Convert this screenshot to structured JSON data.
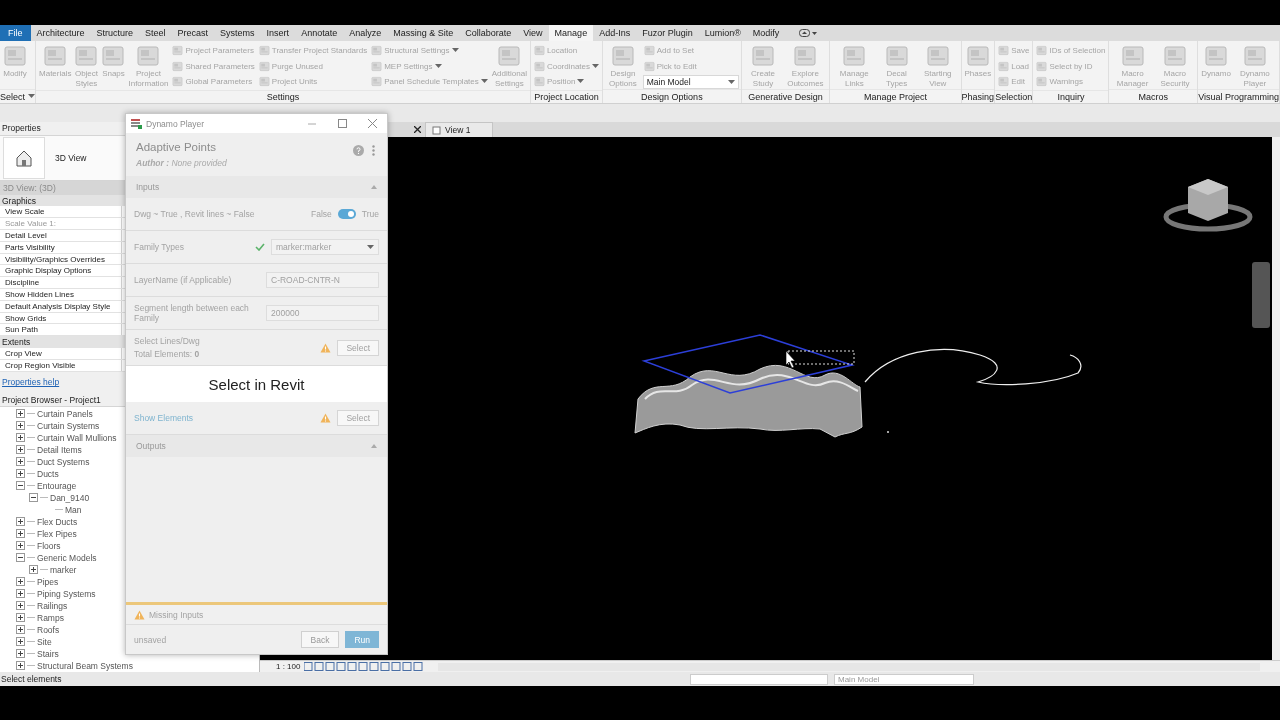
{
  "ribbon": {
    "tabs": [
      {
        "label": "File",
        "kind": "application",
        "selected": false
      },
      {
        "label": "Architecture",
        "kind": "tab",
        "selected": false
      },
      {
        "label": "Structure",
        "kind": "tab",
        "selected": false
      },
      {
        "label": "Steel",
        "kind": "tab",
        "selected": false
      },
      {
        "label": "Precast",
        "kind": "tab",
        "selected": false
      },
      {
        "label": "Systems",
        "kind": "tab",
        "selected": false
      },
      {
        "label": "Insert",
        "kind": "tab",
        "selected": false
      },
      {
        "label": "Annotate",
        "kind": "tab",
        "selected": false
      },
      {
        "label": "Analyze",
        "kind": "tab",
        "selected": false
      },
      {
        "label": "Massing & Site",
        "kind": "tab",
        "selected": false
      },
      {
        "label": "Collaborate",
        "kind": "tab",
        "selected": false
      },
      {
        "label": "View",
        "kind": "tab",
        "selected": false
      },
      {
        "label": "Manage",
        "kind": "tab",
        "selected": true
      },
      {
        "label": "Add-Ins",
        "kind": "tab",
        "selected": false
      },
      {
        "label": "Fuzor Plugin",
        "kind": "tab",
        "selected": false
      },
      {
        "label": "Lumion®",
        "kind": "tab",
        "selected": false
      },
      {
        "label": "Modify",
        "kind": "tab",
        "selected": false
      }
    ],
    "panels": [
      {
        "label": "Select",
        "menu": true,
        "groups": [
          {
            "kind": "large",
            "items": [
              {
                "label": "Modify"
              }
            ]
          }
        ]
      },
      {
        "label": "Settings",
        "menu": false,
        "groups": [
          {
            "kind": "large",
            "items": [
              {
                "label": "Materials"
              },
              {
                "label": "Object Styles"
              },
              {
                "label": "Snaps"
              },
              {
                "label": "Project Information"
              }
            ]
          },
          {
            "kind": "stack",
            "items": [
              {
                "kind": "tool",
                "label": "Project Parameters",
                "menu": false
              },
              {
                "kind": "tool",
                "label": "Shared Parameters",
                "menu": false
              },
              {
                "kind": "tool",
                "label": "Global Parameters",
                "menu": false
              }
            ]
          },
          {
            "kind": "stack",
            "items": [
              {
                "kind": "tool",
                "label": "Transfer Project Standards",
                "menu": false
              },
              {
                "kind": "tool",
                "label": "Purge Unused",
                "menu": false
              },
              {
                "kind": "tool",
                "label": "Project Units",
                "menu": false
              }
            ]
          },
          {
            "kind": "stack",
            "items": [
              {
                "kind": "tool",
                "label": "Structural Settings",
                "menu": true
              },
              {
                "kind": "tool",
                "label": "MEP Settings",
                "menu": true
              },
              {
                "kind": "tool",
                "label": "Panel Schedule Templates",
                "menu": true
              }
            ]
          },
          {
            "kind": "large",
            "items": [
              {
                "label": "Additional Settings"
              }
            ]
          }
        ]
      },
      {
        "label": "Project Location",
        "menu": false,
        "groups": [
          {
            "kind": "stack",
            "items": [
              {
                "kind": "tool",
                "label": "Location",
                "menu": false
              },
              {
                "kind": "tool",
                "label": "Coordinates",
                "menu": true
              },
              {
                "kind": "tool",
                "label": "Position",
                "menu": true
              }
            ]
          }
        ]
      },
      {
        "label": "Design Options",
        "menu": false,
        "groups": [
          {
            "kind": "large",
            "items": [
              {
                "label": "Design Options"
              }
            ]
          },
          {
            "kind": "stack",
            "items": [
              {
                "kind": "tool",
                "label": "Add to Set",
                "menu": false
              },
              {
                "kind": "tool",
                "label": "Pick to Edit",
                "menu": false
              },
              {
                "kind": "combo",
                "label": "Main Model",
                "menu": true
              }
            ]
          }
        ]
      },
      {
        "label": "Generative Design",
        "menu": false,
        "groups": [
          {
            "kind": "large",
            "items": [
              {
                "label": "Create Study"
              },
              {
                "label": "Explore Outcomes"
              }
            ]
          }
        ]
      },
      {
        "label": "Manage Project",
        "menu": false,
        "groups": [
          {
            "kind": "large",
            "items": [
              {
                "label": "Manage Links"
              },
              {
                "label": "Decal Types"
              },
              {
                "label": "Starting View"
              }
            ]
          }
        ]
      },
      {
        "label": "Phasing",
        "menu": false,
        "groups": [
          {
            "kind": "large",
            "items": [
              {
                "label": "Phases"
              }
            ]
          }
        ]
      },
      {
        "label": "Selection",
        "menu": false,
        "groups": [
          {
            "kind": "stack",
            "items": [
              {
                "kind": "tool",
                "label": "Save",
                "menu": false
              },
              {
                "kind": "tool",
                "label": "Load",
                "menu": false
              },
              {
                "kind": "tool",
                "label": "Edit",
                "menu": false
              }
            ]
          }
        ]
      },
      {
        "label": "Inquiry",
        "menu": false,
        "groups": [
          {
            "kind": "stack",
            "items": [
              {
                "kind": "tool",
                "label": "IDs of Selection",
                "menu": false
              },
              {
                "kind": "tool",
                "label": "Select by ID",
                "menu": false
              },
              {
                "kind": "tool",
                "label": "Warnings",
                "menu": false
              }
            ]
          }
        ]
      },
      {
        "label": "Macros",
        "menu": false,
        "groups": [
          {
            "kind": "large",
            "items": [
              {
                "label": "Macro Manager"
              },
              {
                "label": "Macro Security"
              }
            ]
          }
        ]
      },
      {
        "label": "Visual Programming",
        "menu": false,
        "groups": [
          {
            "kind": "large",
            "items": [
              {
                "label": "Dynamo"
              },
              {
                "label": "Dynamo Player"
              }
            ]
          }
        ]
      }
    ]
  },
  "properties": {
    "title": "Properties",
    "type_name": "3D View",
    "selector": "3D View: (3D)",
    "groups": [
      {
        "name": "Graphics",
        "rows": [
          {
            "label": "View Scale",
            "disabled": false
          },
          {
            "label": "Scale Value    1:",
            "disabled": true
          },
          {
            "label": "Detail Level",
            "disabled": false
          },
          {
            "label": "Parts Visibility",
            "disabled": false
          },
          {
            "label": "Visibility/Graphics Overrides",
            "disabled": false
          },
          {
            "label": "Graphic Display Options",
            "disabled": false
          },
          {
            "label": "Discipline",
            "disabled": false
          },
          {
            "label": "Show Hidden Lines",
            "disabled": false
          },
          {
            "label": "Default Analysis Display Style",
            "disabled": false
          },
          {
            "label": "Show Grids",
            "disabled": false
          },
          {
            "label": "Sun Path",
            "disabled": false
          }
        ]
      },
      {
        "name": "Extents",
        "rows": [
          {
            "label": "Crop View",
            "disabled": false
          },
          {
            "label": "Crop Region Visible",
            "disabled": false
          }
        ]
      }
    ],
    "help_link": "Properties help"
  },
  "project_browser": {
    "title": "Project Browser - Project1",
    "tree": [
      {
        "label": "Curtain Panels",
        "expanded": false
      },
      {
        "label": "Curtain Systems",
        "expanded": false
      },
      {
        "label": "Curtain Wall Mullions",
        "expanded": false
      },
      {
        "label": "Detail Items",
        "expanded": false
      },
      {
        "label": "Duct Systems",
        "expanded": false
      },
      {
        "label": "Ducts",
        "expanded": false
      },
      {
        "label": "Entourage",
        "expanded": true,
        "children": [
          {
            "label": "Dan_9140",
            "expanded": true,
            "children": [
              {
                "label": "Man"
              }
            ]
          }
        ]
      },
      {
        "label": "Flex Ducts",
        "expanded": false
      },
      {
        "label": "Flex Pipes",
        "expanded": false
      },
      {
        "label": "Floors",
        "expanded": false
      },
      {
        "label": "Generic Models",
        "expanded": true,
        "children": [
          {
            "label": "marker",
            "expanded": false
          }
        ]
      },
      {
        "label": "Pipes",
        "expanded": false
      },
      {
        "label": "Piping Systems",
        "expanded": false
      },
      {
        "label": "Railings",
        "expanded": false
      },
      {
        "label": "Ramps",
        "expanded": false
      },
      {
        "label": "Roofs",
        "expanded": false
      },
      {
        "label": "Site",
        "expanded": false
      },
      {
        "label": "Stairs",
        "expanded": false
      },
      {
        "label": "Structural Beam Systems",
        "expanded": false
      }
    ]
  },
  "view": {
    "tabs": [
      {
        "label": "View 1"
      }
    ],
    "scale": "1 : 100"
  },
  "dynamo_player": {
    "window_title": "Dynamo Player",
    "graph_title": "Adaptive Points",
    "author": "**Author :** None provided",
    "inputs_label": "Inputs",
    "inputs": [
      {
        "kind": "toggle",
        "label": "Dwg ~ True , Revit lines ~ False",
        "off_label": "False",
        "on_label": "True",
        "on": true
      },
      {
        "kind": "dropdown",
        "label": "Family Types",
        "valid": true,
        "value": "marker:marker"
      },
      {
        "kind": "text",
        "label": "LayerName (if Applicable)",
        "value": "C-ROAD-CNTR-N"
      },
      {
        "kind": "text",
        "label": "Segment length between each Family",
        "value": "200000"
      },
      {
        "kind": "select",
        "label": "Select Lines/Dwg",
        "count": "Total Elements: **0**",
        "warning": true,
        "button": "Select"
      },
      {
        "kind": "banner",
        "label": "Select in Revit"
      },
      {
        "kind": "select",
        "link": "Show Elements",
        "warning": true,
        "button": "Select"
      }
    ],
    "outputs_label": "Outputs",
    "status": "Missing Inputs",
    "file_state": "unsaved",
    "buttons": [
      {
        "label": "Back",
        "kind": "secondary"
      },
      {
        "label": "Run",
        "kind": "primary"
      }
    ]
  },
  "status_bar": {
    "prompt": "Select elements",
    "design_option": "Main Model"
  }
}
